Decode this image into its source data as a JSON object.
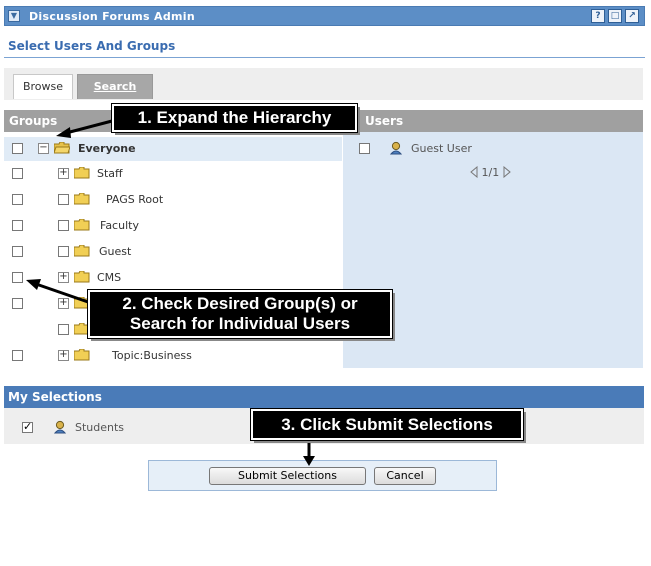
{
  "window": {
    "title": "Discussion Forums Admin",
    "buttons": [
      "?",
      "□",
      "↗"
    ]
  },
  "section_title": "Select Users And Groups",
  "tabs": [
    {
      "label": "Browse",
      "active": true
    },
    {
      "label": "Search",
      "active": false
    }
  ],
  "groups": {
    "header": "Groups",
    "items": [
      {
        "label": "Everyone",
        "expand": "minus",
        "level": 0
      },
      {
        "label": "Staff",
        "expand": "plus",
        "level": 1
      },
      {
        "label": "PAGS Root",
        "expand": "none",
        "level": 1
      },
      {
        "label": "Faculty",
        "expand": "none",
        "level": 1
      },
      {
        "label": "Guest",
        "expand": "none",
        "level": 1
      },
      {
        "label": "CMS",
        "expand": "plus",
        "level": 1
      },
      {
        "label": "",
        "expand": "plus",
        "level": 1
      },
      {
        "label": "",
        "expand": "none",
        "level": 1
      },
      {
        "label": "Topic:Business",
        "expand": "plus",
        "level": 1
      }
    ]
  },
  "users": {
    "header": "Users",
    "items": [
      {
        "label": "Guest User"
      }
    ],
    "pager": "1/1"
  },
  "my_selections": {
    "header": "My Selections",
    "items": [
      {
        "label": "Students",
        "checked": true
      }
    ]
  },
  "actions": {
    "submit": "Submit Selections",
    "cancel": "Cancel"
  },
  "callouts": {
    "step1": "1. Expand the Hierarchy",
    "step2_line1": "2. Check Desired Group(s) or",
    "step2_line2": "Search for Individual Users",
    "step3": "3. Click Submit Selections"
  },
  "colors": {
    "titlebar": "#5c8ec6",
    "accent": "#3a6cb0",
    "selections_header": "#4a7bb8",
    "panel_header": "#a0a0a0",
    "users_panel": "#dbe7f4"
  }
}
